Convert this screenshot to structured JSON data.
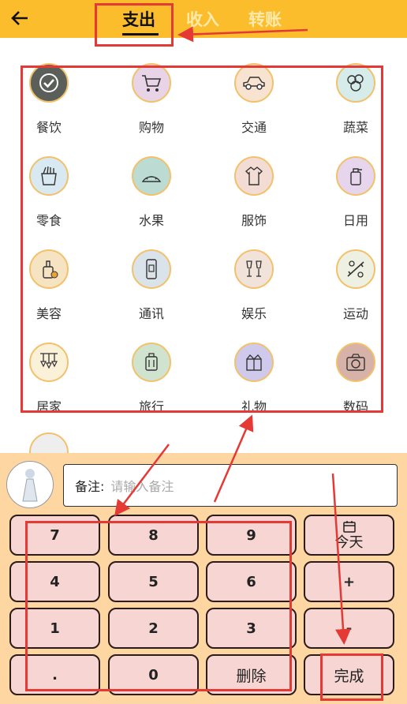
{
  "header": {
    "tabs": [
      {
        "label": "支出"
      },
      {
        "label": "收入"
      },
      {
        "label": "转账"
      }
    ],
    "active_tab": "支出"
  },
  "categories": [
    {
      "label": "餐饮",
      "icon": "dining-icon"
    },
    {
      "label": "购物",
      "icon": "shopping-cart-icon"
    },
    {
      "label": "交通",
      "icon": "car-icon"
    },
    {
      "label": "蔬菜",
      "icon": "vegetables-icon"
    },
    {
      "label": "零食",
      "icon": "snack-icon"
    },
    {
      "label": "水果",
      "icon": "fruit-icon"
    },
    {
      "label": "服饰",
      "icon": "clothing-icon"
    },
    {
      "label": "日用",
      "icon": "daily-goods-icon"
    },
    {
      "label": "美容",
      "icon": "beauty-icon"
    },
    {
      "label": "通讯",
      "icon": "phone-icon"
    },
    {
      "label": "娱乐",
      "icon": "entertainment-icon"
    },
    {
      "label": "运动",
      "icon": "sports-icon"
    },
    {
      "label": "居家",
      "icon": "home-icon"
    },
    {
      "label": "旅行",
      "icon": "luggage-icon"
    },
    {
      "label": "礼物",
      "icon": "gift-icon"
    },
    {
      "label": "数码",
      "icon": "camera-icon"
    }
  ],
  "note": {
    "label": "备注:",
    "placeholder": "请输入备注"
  },
  "keypad": {
    "k7": "7",
    "k8": "8",
    "k9": "9",
    "today": "今天",
    "k4": "4",
    "k5": "5",
    "k6": "6",
    "plus": "+",
    "k1": "1",
    "k2": "2",
    "k3": "3",
    "minus": "-",
    "dot": ".",
    "k0": "0",
    "delete": "删除",
    "done": "完成"
  },
  "colors": {
    "header_bg": "#fbbd2c",
    "keypad_bg": "#fdd6a2",
    "key_bg": "#f6d5d3",
    "annotation_red": "#e53935"
  }
}
